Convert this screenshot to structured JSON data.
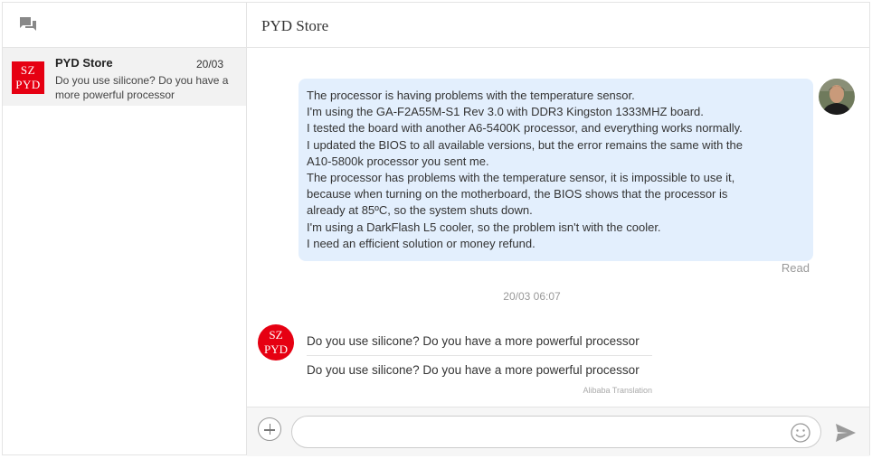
{
  "sidebar": {
    "header_icon": "chat-bubbles-icon",
    "conversations": [
      {
        "logo_line1": "SZ",
        "logo_line2": "PYD",
        "name": "PYD Store",
        "date": "20/03",
        "preview": "Do you use silicone? Do you have a more powerful processor"
      }
    ]
  },
  "chat": {
    "title": "PYD Store",
    "outgoing": {
      "lines": [
        "The processor is having problems with the temperature sensor.",
        "I'm using the GA-F2A55M-S1 Rev 3.0 with DDR3 Kingston 1333MHZ board.",
        "I tested the board with another A6-5400K processor, and everything works normally.",
        "I updated the BIOS to all available versions, but the error remains the same with the",
        "A10-5800k processor you sent me.",
        "The processor has problems with the temperature sensor, it is impossible to use it,",
        "because when turning on the motherboard, the BIOS shows that the processor is",
        "already at 85ºC, so the system shuts down.",
        "I'm using a DarkFlash L5 cooler, so the problem isn't with the cooler.",
        "I need an efficient solution or money refund."
      ],
      "status": "Read"
    },
    "timestamp": "20/03 06:07",
    "incoming": {
      "avatar_line1": "SZ",
      "avatar_line2": "PYD",
      "text": "Do you use silicone? Do you have a more powerful processor",
      "translation": "Do you use silicone? Do you have a more powerful processor",
      "credit": "Alibaba Translation"
    }
  },
  "composer": {
    "placeholder": "",
    "value": ""
  },
  "colors": {
    "brand_red": "#e60012",
    "outgoing_bubble": "#e3effd",
    "selected_conversation": "#f2f2f2"
  }
}
